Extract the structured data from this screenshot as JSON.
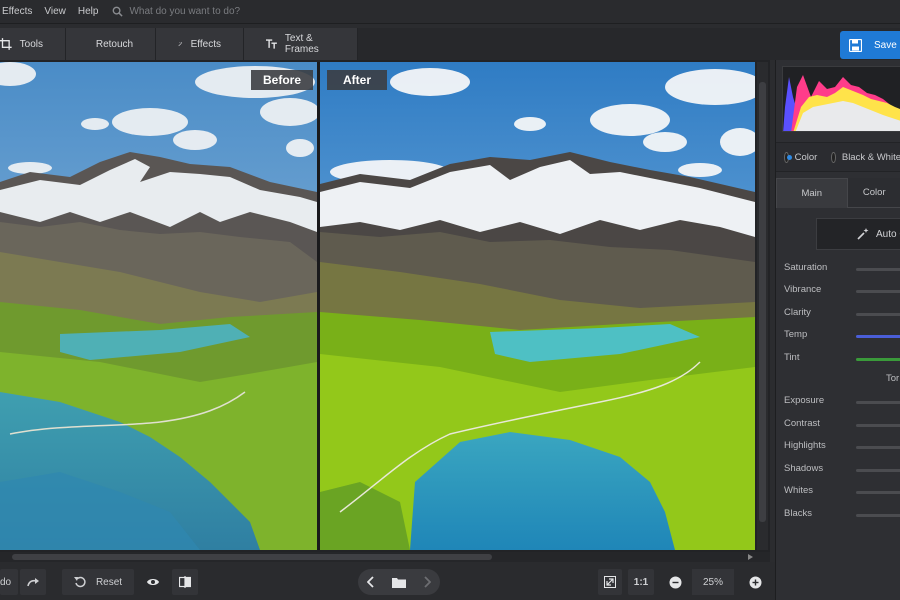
{
  "menu": {
    "items": [
      "Effects",
      "View",
      "Help"
    ],
    "search_placeholder": "What do you want to do?"
  },
  "toolbar": {
    "tabs": [
      {
        "label": "Tools",
        "icon": "crop-icon"
      },
      {
        "label": "Retouch",
        "icon": "brush-icon"
      },
      {
        "label": "Effects",
        "icon": "magic-wand-icon"
      },
      {
        "label": "Text & Frames",
        "icon": "text-icon"
      }
    ],
    "save_label": "Save"
  },
  "canvas": {
    "before_label": "Before",
    "after_label": "After"
  },
  "bottombar": {
    "undo_label": "do",
    "reset_label": "Reset",
    "ratio_label": "1:1",
    "zoom": "25%"
  },
  "panel": {
    "color_label": "Color",
    "bw_label": "Black & White",
    "tabs": [
      "Main",
      "Color"
    ],
    "auto_label": "Auto C",
    "color_sliders": [
      {
        "label": "Saturation",
        "color": "#8a8b8f"
      },
      {
        "label": "Vibrance",
        "color": "#8a8b8f"
      },
      {
        "label": "Clarity",
        "color": "#8a8b8f"
      },
      {
        "label": "Temp",
        "color": "#4a5ed8"
      },
      {
        "label": "Tint",
        "color": "#3a9a3a"
      }
    ],
    "tone_label": "Tor",
    "tone_sliders": [
      {
        "label": "Exposure"
      },
      {
        "label": "Contrast"
      },
      {
        "label": "Highlights"
      },
      {
        "label": "Shadows"
      },
      {
        "label": "Whites"
      },
      {
        "label": "Blacks"
      }
    ]
  },
  "colors": {
    "accent": "#1f7ad6"
  }
}
